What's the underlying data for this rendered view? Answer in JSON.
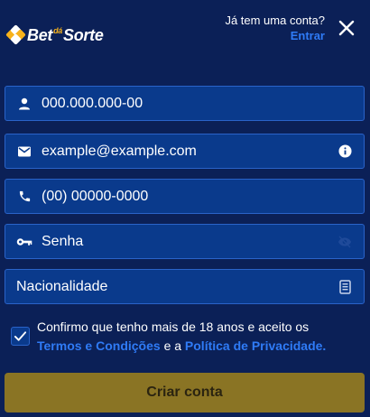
{
  "header": {
    "logo_text_left": "Bet",
    "logo_text_small": "dá",
    "logo_text_right": "Sorte",
    "account_question": "Já tem uma conta?",
    "login_link": "Entrar",
    "close_icon": "close-icon"
  },
  "form": {
    "cpf": {
      "value": "000.000.000-00",
      "icon": "person-icon"
    },
    "email": {
      "value": "example@example.com",
      "icon": "mail-icon",
      "right_icon": "info-icon"
    },
    "phone": {
      "value": "(00) 00000-0000",
      "icon": "phone-icon"
    },
    "password": {
      "value": "Senha",
      "icon": "key-icon",
      "right_icon": "eye-off-icon"
    },
    "nationality": {
      "value": "Nacionalidade",
      "right_icon": "document-icon"
    }
  },
  "consent": {
    "checked": true,
    "text_before": "Confirmo que tenho mais de 18 anos e aceito os",
    "terms_link": "Termos e Condições",
    "conjunction": "e a",
    "privacy_link": "Política de Privacidade."
  },
  "submit": {
    "label": "Criar conta"
  },
  "colors": {
    "background": "#0b2057",
    "field_background": "#0a3a8c",
    "field_border": "#2a63c9",
    "link": "#2f7bf6",
    "button": "#8a7424",
    "logo_accent": "#f7b21b"
  }
}
